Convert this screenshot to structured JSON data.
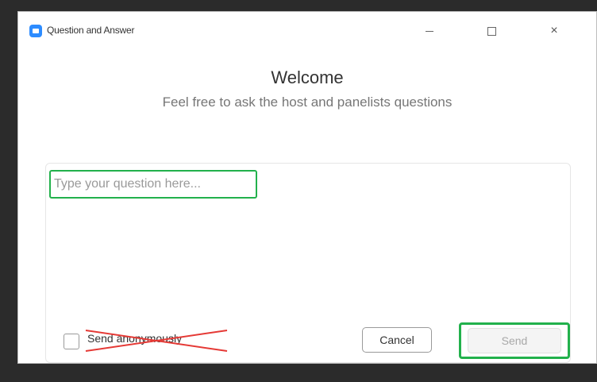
{
  "window": {
    "title": "Question and Answer",
    "app_icon": "zoom-logo-icon",
    "controls": {
      "minimize": "minimize-icon",
      "maximize": "maximize-icon",
      "close_glyph": "×"
    }
  },
  "main": {
    "heading": "Welcome",
    "subtitle": "Feel free to ask the host and panelists questions"
  },
  "compose": {
    "question_placeholder": "Type your question here...",
    "question_value": "",
    "anonymous_label": "Send anonymously",
    "anonymous_checked": false,
    "cancel_label": "Cancel",
    "send_label": "Send"
  },
  "colors": {
    "highlight": "#22b14c",
    "annotation_strike": "#e53935",
    "brand": "#2d8cff"
  }
}
